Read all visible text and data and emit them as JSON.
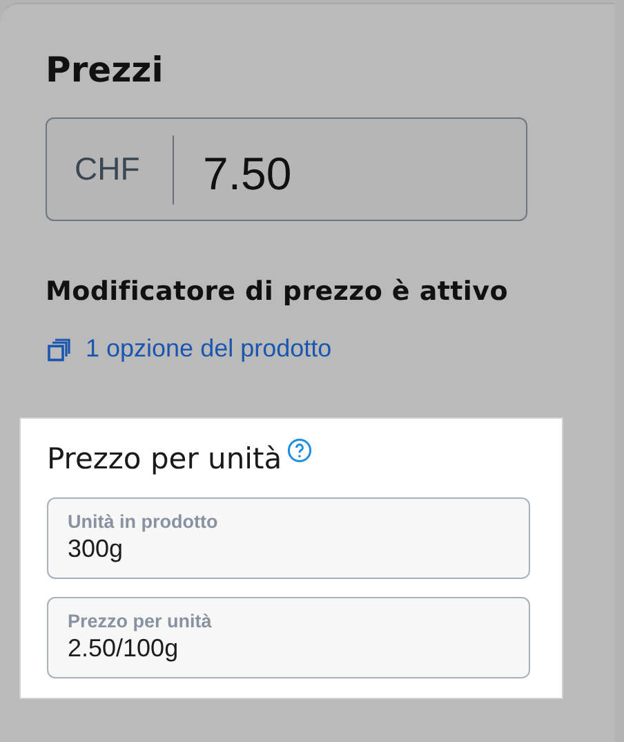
{
  "title": "Prezzi",
  "price": {
    "currency": "CHF",
    "value": "7.50"
  },
  "modifier": {
    "heading": "Modificatore di prezzo è attivo",
    "link": "1 opzione del prodotto"
  },
  "unit_price": {
    "title": "Prezzo per unità",
    "fields": [
      {
        "label": "Unità in prodotto",
        "value": "300g"
      },
      {
        "label": "Prezzo per unità",
        "value": "2.50/100g"
      }
    ]
  }
}
